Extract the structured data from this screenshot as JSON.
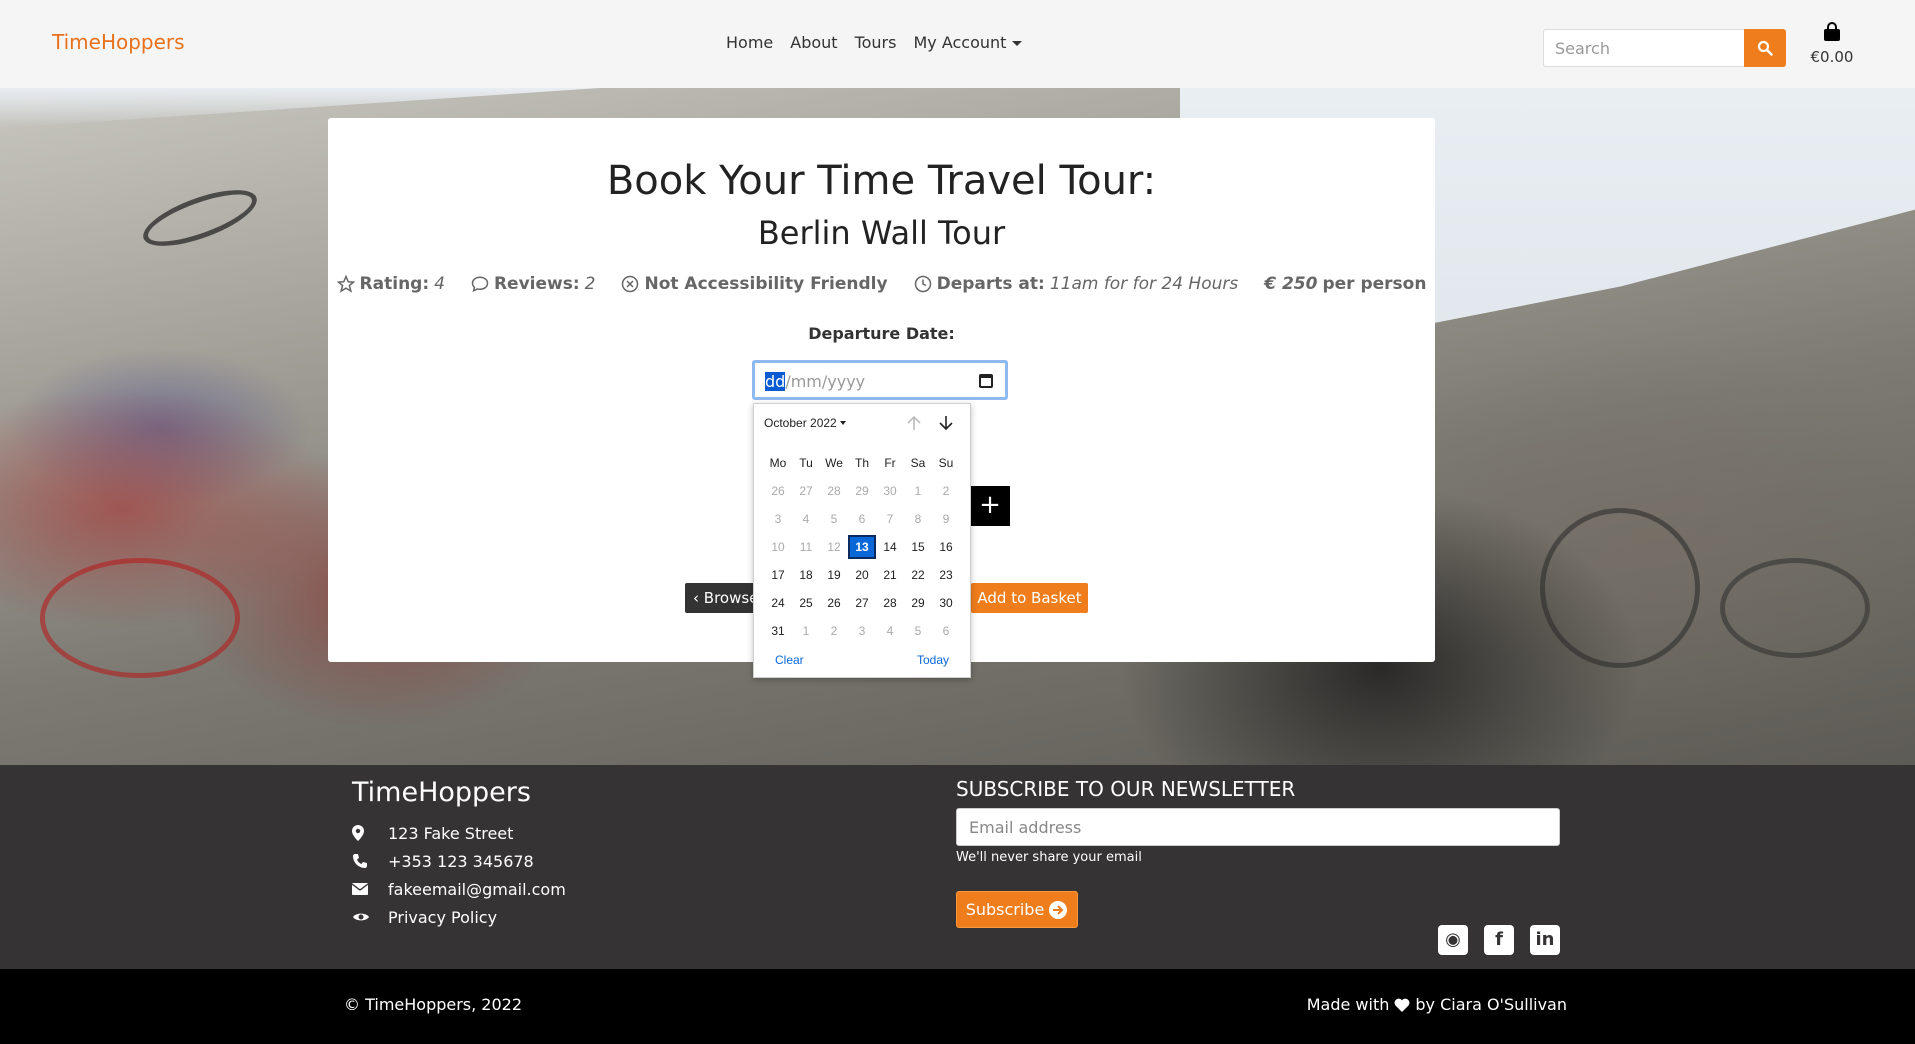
{
  "nav": {
    "brand": "TimeHoppers",
    "links": [
      "Home",
      "About",
      "Tours"
    ],
    "account_label": "My Account",
    "search_placeholder": "Search",
    "basket_total": "€0.00"
  },
  "tour": {
    "heading": "Book Your Time Travel Tour:",
    "name": "Berlin Wall Tour",
    "rating_label": "Rating:",
    "rating_value": "4",
    "reviews_label": "Reviews:",
    "reviews_value": "2",
    "accessibility": "Not Accessibility Friendly",
    "departs_label": "Departs at:",
    "departs_value": "11am for for 24 Hours",
    "price_value": "€ 250",
    "price_suffix": "per person",
    "departure_label": "Departure Date:",
    "date_placeholder_day": "dd",
    "date_placeholder_rest": "/mm/yyyy",
    "plus_label": "+",
    "browse_label": "Browse",
    "add_label": "Add to Basket"
  },
  "calendar": {
    "month_label": "October 2022",
    "weekdays": [
      "Mo",
      "Tu",
      "We",
      "Th",
      "Fr",
      "Sa",
      "Su"
    ],
    "weeks": [
      [
        "26",
        "27",
        "28",
        "29",
        "30",
        "1",
        "2"
      ],
      [
        "3",
        "4",
        "5",
        "6",
        "7",
        "8",
        "9"
      ],
      [
        "10",
        "11",
        "12",
        "13",
        "14",
        "15",
        "16"
      ],
      [
        "17",
        "18",
        "19",
        "20",
        "21",
        "22",
        "23"
      ],
      [
        "24",
        "25",
        "26",
        "27",
        "28",
        "29",
        "30"
      ],
      [
        "31",
        "1",
        "2",
        "3",
        "4",
        "5",
        "6"
      ]
    ],
    "selected": "13",
    "clear_label": "Clear",
    "today_label": "Today"
  },
  "footer": {
    "brand": "TimeHoppers",
    "address": "123 Fake Street",
    "phone": "+353 123 345678",
    "email": "fakeemail@gmail.com",
    "privacy": "Privacy Policy",
    "newsletter_title": "SUBSCRIBE TO OUR NEWSLETTER",
    "email_placeholder": "Email address",
    "email_help": "We'll never share your email",
    "subscribe_label": "Subscribe",
    "copyright": "© TimeHoppers, 2022",
    "made_prefix": "Made with",
    "made_suffix": "by Ciara O'Sullivan"
  },
  "colors": {
    "accent": "#ef7d1b",
    "footer_bg": "#353334",
    "selected_day": "#0a67d8"
  }
}
